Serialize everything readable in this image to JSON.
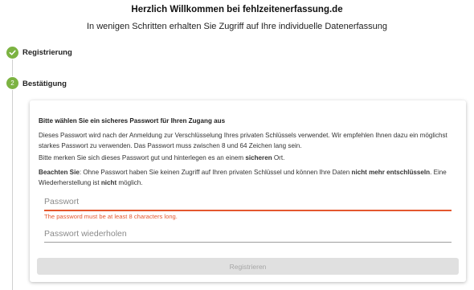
{
  "header": {
    "title": "Herzlich Willkommen bei fehlzeitenerfassung.de",
    "subtitle": "In wenigen Schritten erhalten Sie Zugriff auf Ihre individuelle Datenerfassung"
  },
  "steps": [
    {
      "label": "Registrierung",
      "state": "completed",
      "icon": "check-icon"
    },
    {
      "number": "2",
      "label": "Bestätigung",
      "state": "active"
    }
  ],
  "colors": {
    "step_green": "#7cb342",
    "error": "#e4572e"
  },
  "card": {
    "heading": "Bitte wählen Sie ein sicheres Passwort für Ihren Zugang aus",
    "para1": "Dieses Passwort wird nach der Anmeldung zur Verschlüsselung Ihres privaten Schlüssels verwendet. Wir empfehlen Ihnen dazu ein möglichst starkes Passwort zu verwenden. Das Passwort muss zwischen 8 und 64 Zeichen lang sein.",
    "para2": {
      "before": "Bitte merken Sie sich dieses Passwort gut und hinterlegen es an einem ",
      "bold": "sicheren",
      "after": " Ort."
    },
    "para3": {
      "label": "Beachten Sie",
      "text1": ": Ohne Passwort haben Sie keinen Zugriff auf Ihren privaten Schlüssel und können Ihre Daten ",
      "bold1": "nicht mehr entschlüsseln",
      "text2": ". Eine Wiederherstellung ist ",
      "bold2": "nicht",
      "text3": " möglich."
    },
    "password": {
      "placeholder": "Passwort",
      "value": "",
      "error": "The password must be at least 8 characters long."
    },
    "password_repeat": {
      "placeholder": "Passwort wiederholen",
      "value": ""
    },
    "submit_label": "Registrieren"
  }
}
